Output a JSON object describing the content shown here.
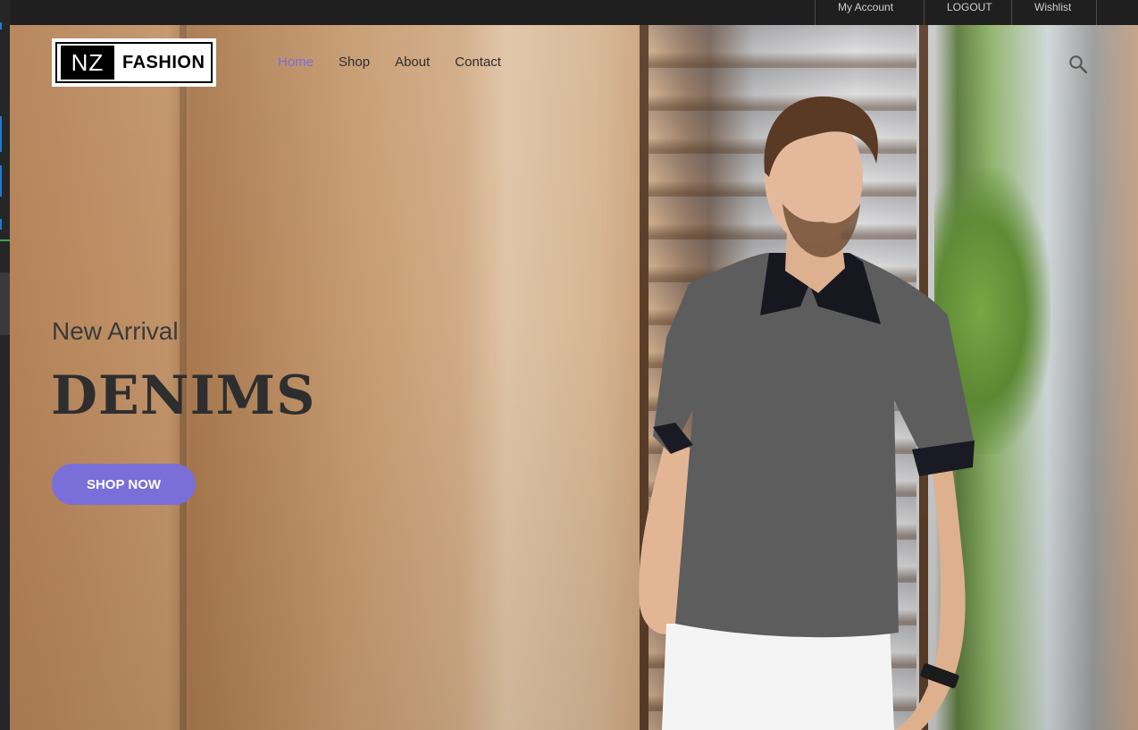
{
  "topbar": {
    "links": [
      "My Account",
      "LOGOUT",
      "Wishlist"
    ]
  },
  "header": {
    "logo": {
      "mark": "NZ",
      "word": "FASHION"
    },
    "nav": [
      {
        "label": "Home",
        "active": true
      },
      {
        "label": "Shop",
        "active": false
      },
      {
        "label": "About",
        "active": false
      },
      {
        "label": "Contact",
        "active": false
      }
    ],
    "search_icon": "search-icon"
  },
  "hero": {
    "subtitle": "New Arrival",
    "title": "DENIMS",
    "cta_label": "SHOP NOW",
    "image": "man-in-grey-polo-shirt-photo"
  },
  "colors": {
    "accent": "#7a6fd8",
    "topbar": "#1f1f1f",
    "text_dark": "#2e2e2e"
  }
}
